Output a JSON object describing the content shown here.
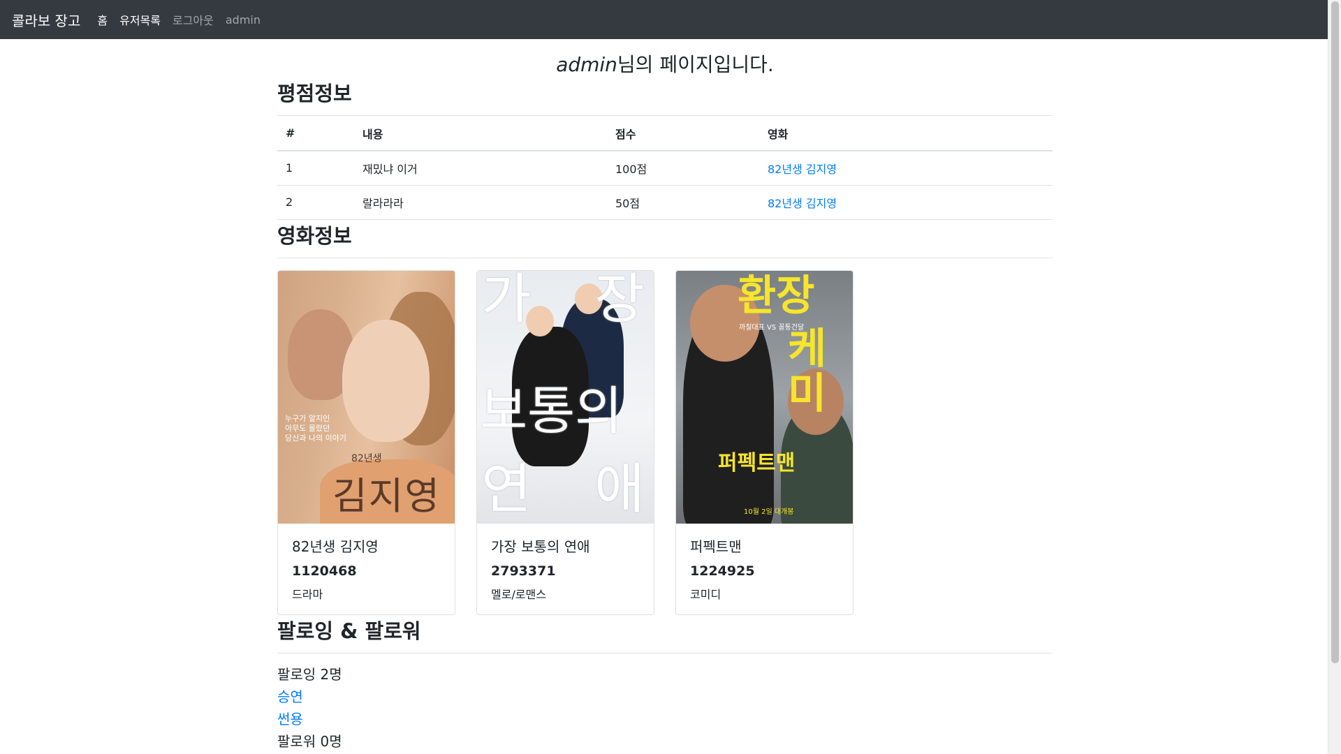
{
  "navbar": {
    "brand": "콜라보 장고",
    "links": [
      "홈",
      "유저목록",
      "로그아웃",
      "admin"
    ]
  },
  "page": {
    "username": "admin",
    "title_suffix": "님의 페이지입니다."
  },
  "ratings": {
    "heading": "평점정보",
    "columns": [
      "#",
      "내용",
      "점수",
      "영화"
    ],
    "rows": [
      {
        "num": "1",
        "content": "재밌냐 이거",
        "score": "100점",
        "movie": "82년생 김지영"
      },
      {
        "num": "2",
        "content": "랄라라라",
        "score": "50점",
        "movie": "82년생 김지영"
      }
    ]
  },
  "movies": {
    "heading": "영화정보",
    "cards": [
      {
        "title": "82년생 김지영",
        "count": "1120468",
        "genre": "드라마",
        "poster": {
          "title": "김지영",
          "subtitle": "82년생",
          "tagline": "누구가 알지인\n아무도 몰랐던\n당신과 나의 이야기"
        }
      },
      {
        "title": "가장 보통의 연애",
        "count": "2793371",
        "genre": "멜로/로맨스",
        "poster": {
          "chars": [
            "가",
            "장",
            "보통의",
            "연",
            "애"
          ]
        }
      },
      {
        "title": "퍼펙트맨",
        "count": "1224925",
        "genre": "코미디",
        "poster": {
          "top1": "환장",
          "top2": "케미",
          "sub": "까칠대표 VS 꼴통건달",
          "bottom": "퍼펙트맨",
          "date": "10월 2일 대개봉"
        }
      }
    ]
  },
  "follow": {
    "heading": "팔로잉 & 팔로워",
    "following_label": "팔로잉 2명",
    "following": [
      "승연",
      "썬용"
    ],
    "followers_label": "팔로워 0명"
  },
  "colors": {
    "navbar_bg": "#343a40",
    "link": "#007bff"
  }
}
